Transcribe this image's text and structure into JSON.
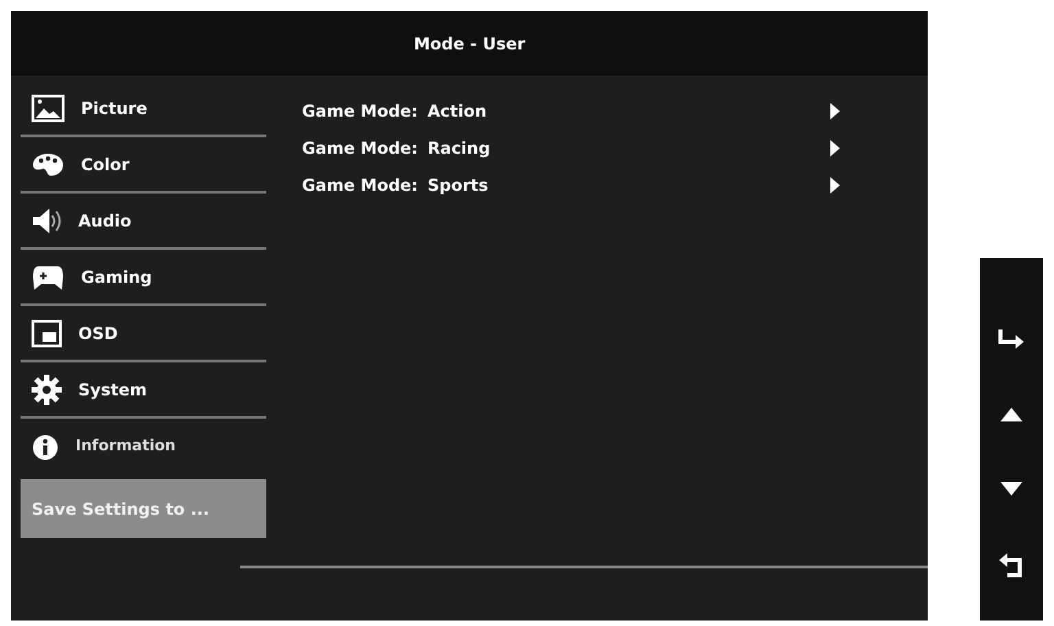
{
  "window": {
    "title": "Mode - User"
  },
  "sidebar": {
    "items": [
      {
        "label": "Picture",
        "selected": false
      },
      {
        "label": "Color",
        "selected": false
      },
      {
        "label": "Audio",
        "selected": false
      },
      {
        "label": "Gaming",
        "selected": false
      },
      {
        "label": "OSD",
        "selected": false
      },
      {
        "label": "System",
        "selected": false
      },
      {
        "label": "Information",
        "selected": false
      },
      {
        "label": "Save Settings to ...",
        "selected": true
      }
    ]
  },
  "options": [
    {
      "label": "Game Mode:",
      "value": "Action"
    },
    {
      "label": "Game Mode:",
      "value": "Racing"
    },
    {
      "label": "Game Mode:",
      "value": "Sports"
    }
  ]
}
